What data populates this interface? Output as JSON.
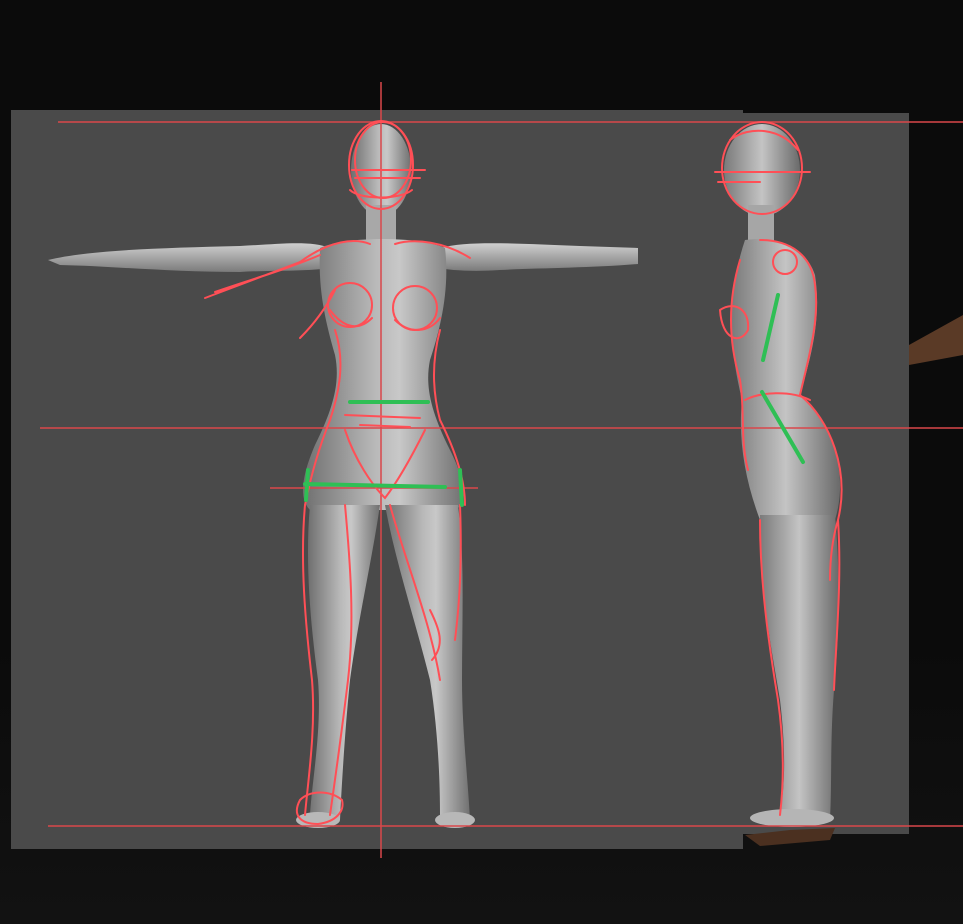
{
  "scene": {
    "background_color": "#0b0b0b",
    "panel_color": "#4a4a4a",
    "figure_fill": "#9c9c9c",
    "figure_highlight": "#c9c9c9",
    "sketch_red": "#ff4f56",
    "guide_red": "#d9474b",
    "measure_green": "#2fbf55",
    "props_brown": "#5a3a26"
  },
  "views": [
    "front-view",
    "side-view"
  ]
}
